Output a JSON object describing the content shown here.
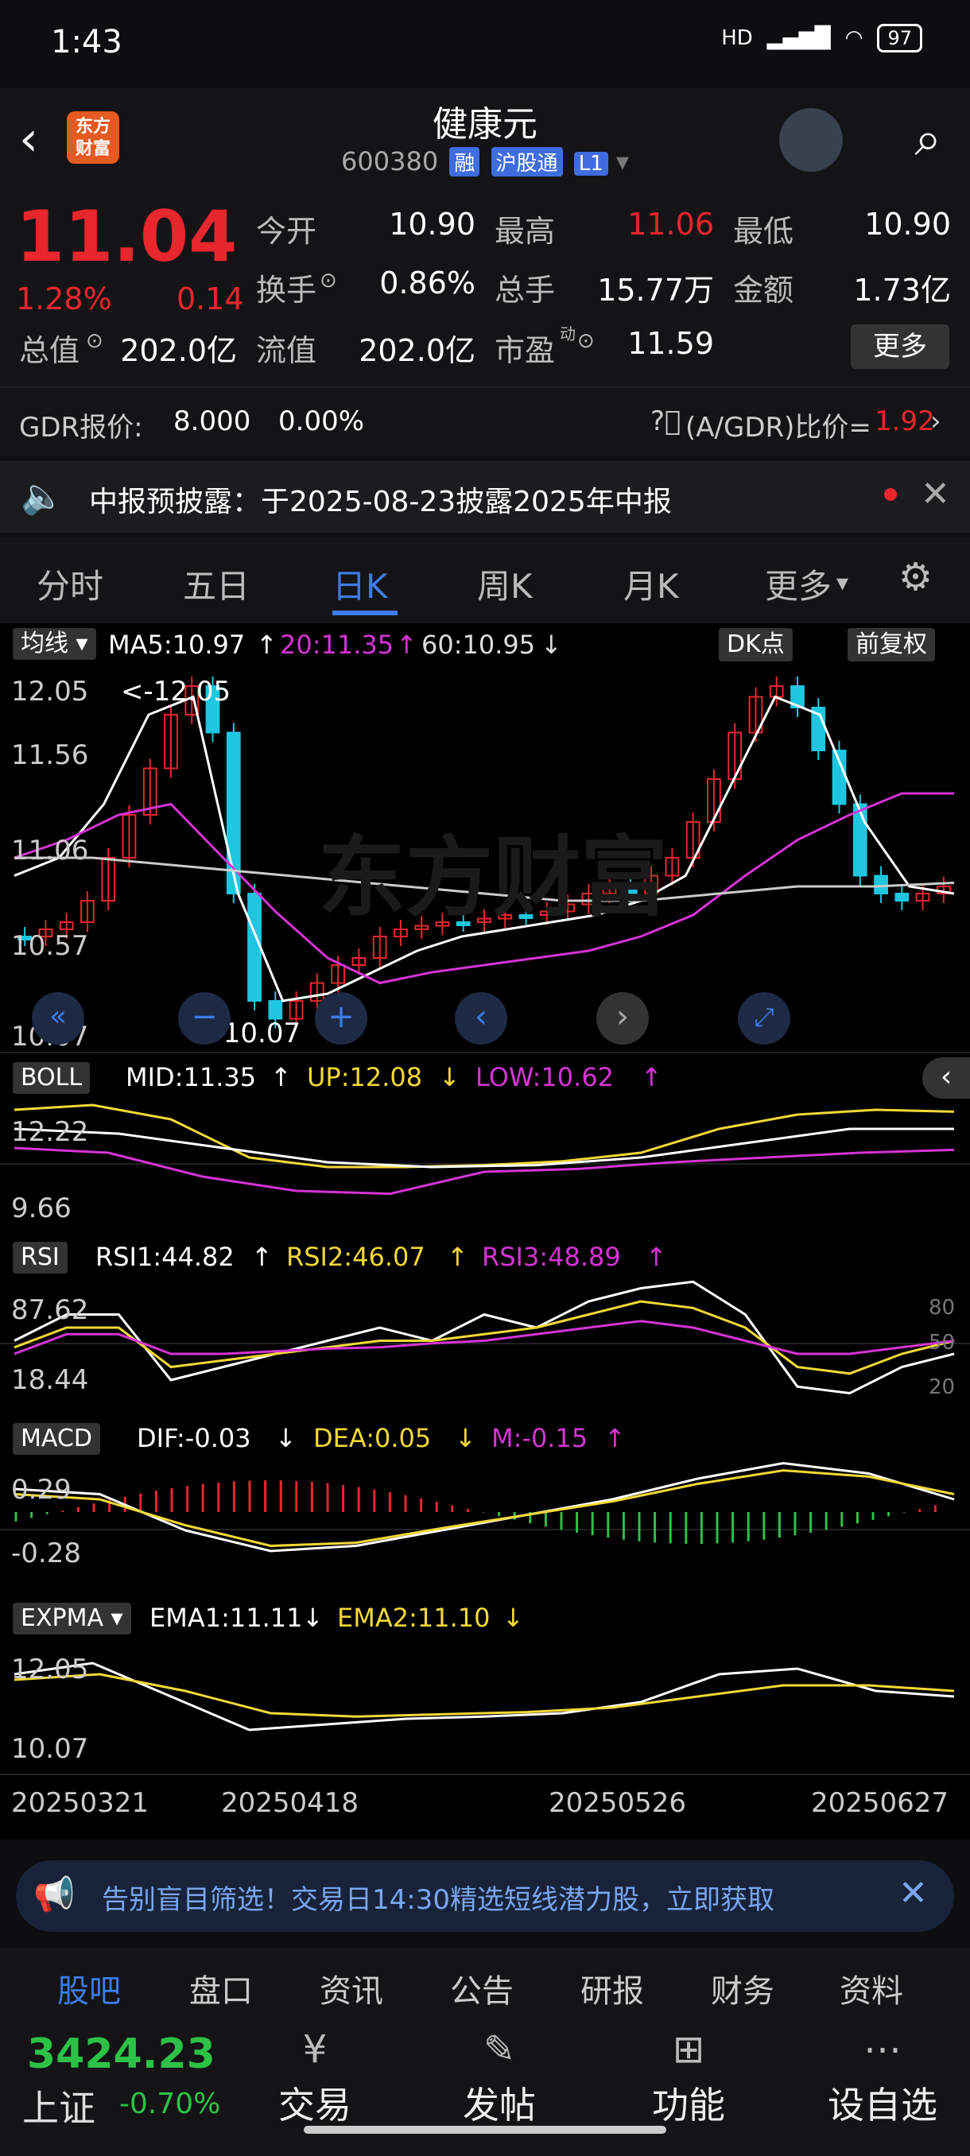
{
  "status": {
    "time": "1:43",
    "network": "HD",
    "battery": "97"
  },
  "header": {
    "logo": "东方\n财富",
    "name": "健康元",
    "code": "600380",
    "tags": [
      "融",
      "沪股通",
      "L1"
    ]
  },
  "quote": {
    "price": "11.04",
    "pct": "1.28%",
    "chg": "0.14",
    "fields": [
      [
        "今开",
        "10.90"
      ],
      [
        "最高",
        "11.06"
      ],
      [
        "最低",
        "10.90"
      ],
      [
        "换手",
        "0.86%"
      ],
      [
        "总手",
        "15.77万"
      ],
      [
        "金额",
        "1.73亿"
      ],
      [
        "总值",
        "202.0亿"
      ],
      [
        "流值",
        "202.0亿"
      ],
      [
        "市盈",
        "11.59"
      ]
    ],
    "more": "更多",
    "pe_sup": "动"
  },
  "gdr": {
    "label": "GDR报价:",
    "price": "8.000",
    "pct": "0.00%",
    "ratio_label": "(A/GDR)比价=",
    "ratio": "1.92"
  },
  "notice": {
    "text": "中报预披露：于2025-08-23披露2025年中报"
  },
  "tabs": [
    "分时",
    "五日",
    "日K",
    "周K",
    "月K",
    "更多"
  ],
  "main": {
    "ma_label": "均线",
    "ma5": "MA5:10.97",
    "ma20": "20:11.35",
    "ma60": "60:10.95",
    "dk": "DK点",
    "fq": "前复权",
    "y_ticks": [
      "12.05",
      "11.56",
      "11.06",
      "10.57",
      "10.07"
    ],
    "high_note": "<-12.05",
    "low_note": "<-10.07"
  },
  "boll": {
    "name": "BOLL",
    "mid": "MID:11.35",
    "up": "UP:12.08",
    "low": "LOW:10.62",
    "y_ticks": [
      "12.22",
      "9.66"
    ]
  },
  "rsi": {
    "name": "RSI",
    "r1": "RSI1:44.82",
    "r2": "RSI2:46.07",
    "r3": "RSI3:48.89",
    "y_ticks": [
      "87.62",
      "18.44"
    ],
    "levels": [
      "80",
      "50",
      "20"
    ]
  },
  "macd": {
    "name": "MACD",
    "dif": "DIF:-0.03",
    "dea": "DEA:0.05",
    "m": "M:-0.15",
    "y_ticks": [
      "0.29",
      "-0.28"
    ]
  },
  "expma": {
    "name": "EXPMA",
    "e1": "EMA1:11.11",
    "e2": "EMA2:11.10",
    "y_ticks": [
      "12.05",
      "10.07"
    ]
  },
  "dates": [
    "20250321",
    "20250418",
    "20250526",
    "20250627"
  ],
  "watermark": "东方财富",
  "banner": {
    "text": "告别盲目筛选！交易日14:30精选短线潜力股，立即获取"
  },
  "subtabs": [
    "股吧",
    "盘口",
    "资讯",
    "公告",
    "研报",
    "财务",
    "资料"
  ],
  "index": {
    "value": "3424.23",
    "name": "上证",
    "pct": "-0.70%"
  },
  "bottom_nav": [
    "交易",
    "发帖",
    "功能",
    "设自选"
  ],
  "colors": {
    "up": "#e8262e",
    "down": "#1ec6e0",
    "ma5": "#ffffff",
    "ma20": "#d633d6",
    "ma60": "#cccccc",
    "accent": "#3d7ce8",
    "yellow": "#f2d836"
  }
}
